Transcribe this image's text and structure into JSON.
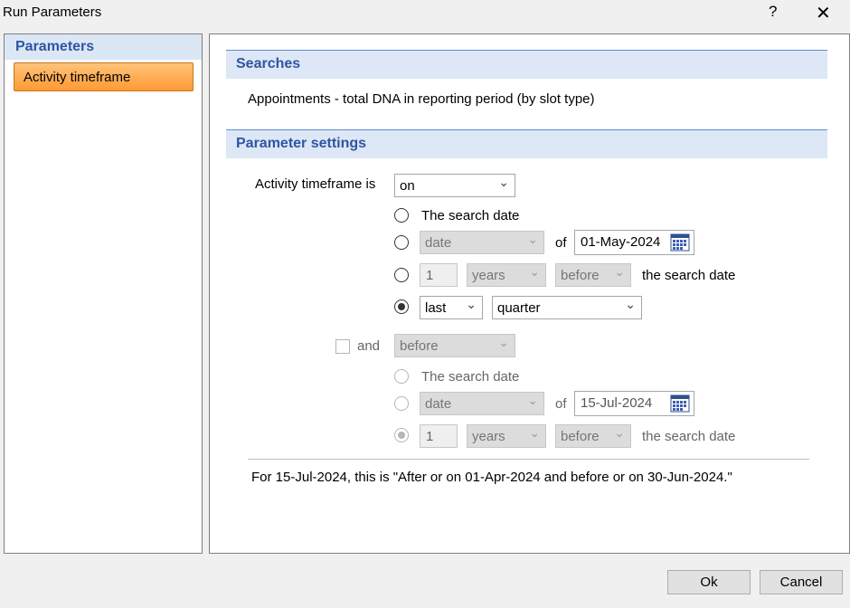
{
  "window": {
    "title": "Run Parameters",
    "help_label": "?",
    "close_label": "✕"
  },
  "sidebar": {
    "header": "Parameters",
    "items": [
      {
        "label": "Activity timeframe",
        "selected": true
      }
    ]
  },
  "searches": {
    "header": "Searches",
    "description": "Appointments - total DNA in reporting period (by slot type)"
  },
  "parameter_settings": {
    "header": "Parameter settings",
    "activity_label": "Activity timeframe is",
    "activity_value": "on",
    "group1": {
      "search_date_label": "The search date",
      "date_select": "date",
      "of_label": "of",
      "date_value": "01-May-2024",
      "num_value": "1",
      "unit_select": "years",
      "direction_select": "before",
      "the_search_date": "the search date",
      "last_select": "last",
      "period_select": "quarter",
      "selected_option": 4
    },
    "and_label": "and",
    "and_select": "before",
    "group2": {
      "search_date_label": "The search date",
      "date_select": "date",
      "of_label": "of",
      "date_value": "15-Jul-2024",
      "num_value": "1",
      "unit_select": "years",
      "direction_select": "before",
      "the_search_date": "the search date"
    },
    "summary": "For 15-Jul-2024, this is \"After or on 01-Apr-2024 and before or on 30-Jun-2024.\""
  },
  "footer": {
    "ok_label": "Ok",
    "cancel_label": "Cancel"
  },
  "colors": {
    "accent": "#2f55a4",
    "section_bg": "#dde7f5",
    "selected_item": "#ff9a33"
  },
  "icons": {
    "calendar": "calendar-icon",
    "chevron": "chevron-down-icon",
    "close": "close-icon",
    "help": "help-icon"
  }
}
